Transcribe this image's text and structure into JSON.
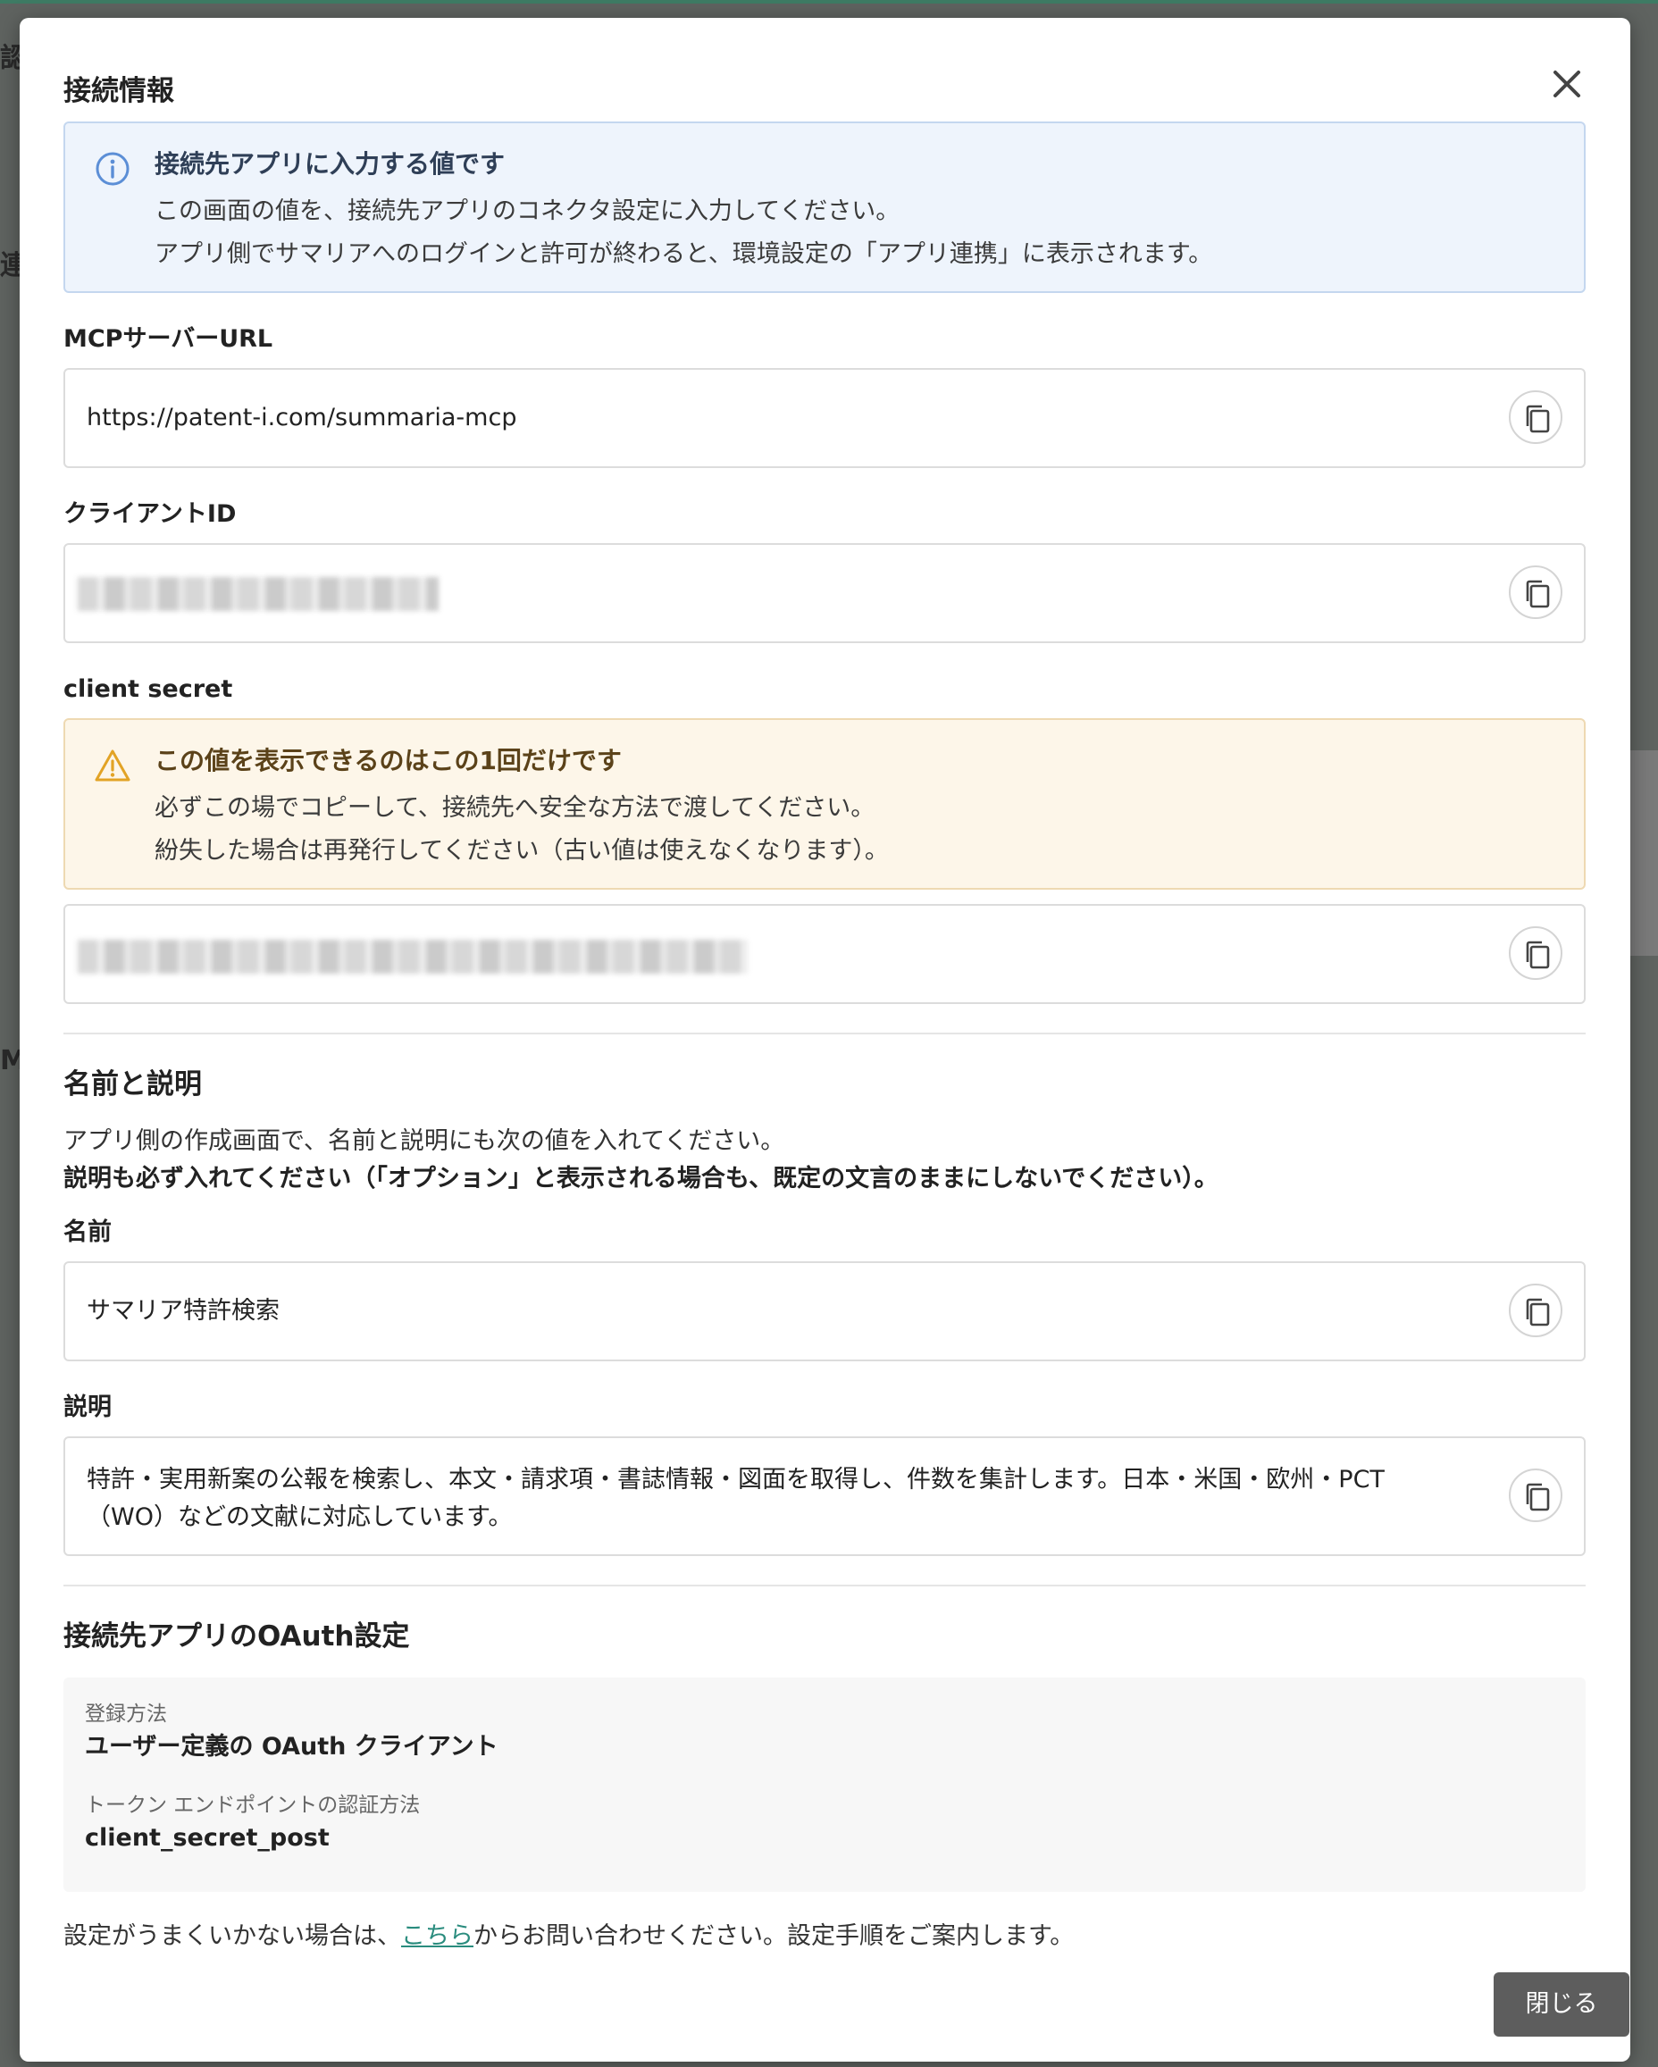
{
  "background": {
    "peek_texts": [
      "認",
      "連",
      "MC"
    ]
  },
  "modal": {
    "title": "接続情報",
    "close_label": "閉じる"
  },
  "info": {
    "title": "接続先アプリに入力する値です",
    "line1": "この画面の値を、接続先アプリのコネクタ設定に入力してください。",
    "line2": "アプリ側でサマリアへのログインと許可が終わると、環境設定の「アプリ連携」に表示されます。"
  },
  "fields": {
    "mcp_url": {
      "label": "MCPサーバーURL",
      "value": "https://patent-i.com/summaria-mcp"
    },
    "client_id": {
      "label": "クライアントID"
    },
    "client_secret": {
      "label": "client secret"
    }
  },
  "warning": {
    "title": "この値を表示できるのはこの1回だけです",
    "line1": "必ずこの場でコピーして、接続先へ安全な方法で渡してください。",
    "line2": "紛失した場合は再発行してください（古い値は使えなくなります）。"
  },
  "name_section": {
    "heading": "名前と説明",
    "desc": "アプリ側の作成画面で、名前と説明にも次の値を入れてください。",
    "desc_bold": "説明も必ず入れてください（「オプション」と表示される場合も、既定の文言のままにしないでください）。",
    "name_label": "名前",
    "name_value": "サマリア特許検索",
    "description_label": "説明",
    "description_value": "特許・実用新案の公報を検索し、本文・請求項・書誌情報・図面を取得し、件数を集計します。日本・米国・欧州・PCT（WO）などの文献に対応しています。"
  },
  "oauth_section": {
    "heading": "接続先アプリのOAuth設定",
    "reg_method_label": "登録方法",
    "reg_method_value": "ユーザー定義の OAuth クライアント",
    "auth_method_label": "トークン エンドポイントの認証方法",
    "auth_method_value": "client_secret_post"
  },
  "footer": {
    "note_before": "設定がうまくいかない場合は、",
    "link_text": "こちら",
    "note_after": "からお問い合わせください。設定手順をご案内します。",
    "close_button": "閉じる"
  },
  "colors": {
    "info_bg": "#eef4fc",
    "warn_bg": "#fdf6e9",
    "link": "#2a8c7e",
    "close_button_bg": "#5d5d5d"
  }
}
